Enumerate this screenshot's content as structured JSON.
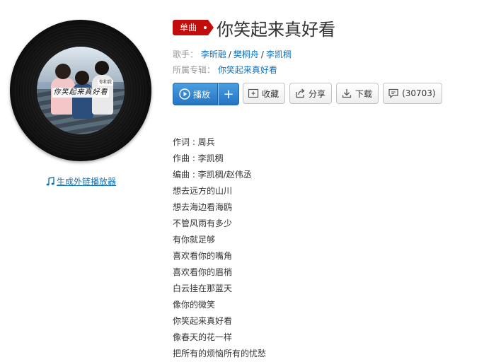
{
  "cover": {
    "title_text": "你笑起来真好看",
    "mini_label": "你和我"
  },
  "external_link": {
    "label": "生成外链播放器",
    "icon": "music-note-icon"
  },
  "song": {
    "badge": "单曲",
    "title": "你笑起来真好看"
  },
  "meta": {
    "singers_label": "歌手：",
    "singers": [
      "李昕融",
      "樊桐舟",
      "李凯稠"
    ],
    "album_label": "所属专辑：",
    "album": "你笑起来真好看"
  },
  "buttons": {
    "play": "播放",
    "add": "+",
    "collect": "收藏",
    "share": "分享",
    "download": "下载",
    "comments": "(30703)"
  },
  "lyrics": [
    "作词 : 周兵",
    "作曲 : 李凯稠",
    "编曲 : 李凯稠/赵伟丞",
    "想去远方的山川",
    "想去海边看海鸥",
    "不管风雨有多少",
    "有你就足够",
    "喜欢看你的嘴角",
    "喜欢看你的眉梢",
    "白云挂在那蓝天",
    "像你的微笑",
    "你笑起来真好看",
    "像春天的花一样",
    "把所有的烦恼所有的忧愁"
  ],
  "colors": {
    "accent_red": "#c10d0c",
    "link_blue": "#0c73c2",
    "play_blue": "#2574c4"
  }
}
